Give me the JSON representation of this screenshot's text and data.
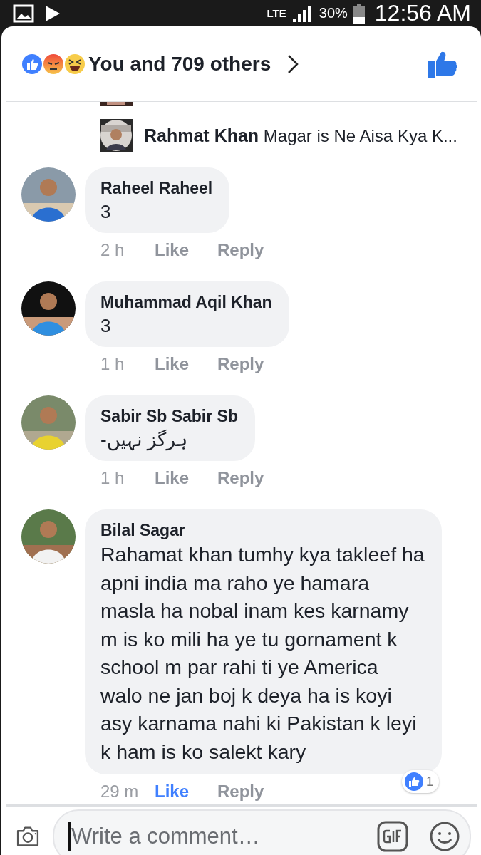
{
  "status_bar": {
    "network": "LTE",
    "battery": "30%",
    "time": "12:56 AM"
  },
  "reactions_header": {
    "summary": "You and 709 others",
    "liked": true
  },
  "reply_preview": {
    "author": "Rahmat Khan",
    "text": "Magar is Ne Aisa Kya K..."
  },
  "comments": [
    {
      "author": "Raheel Raheel",
      "text": "3",
      "time": "2 h",
      "like": "Like",
      "reply": "Reply",
      "liked": false
    },
    {
      "author": "Muhammad Aqil Khan",
      "text": "3",
      "time": "1 h",
      "like": "Like",
      "reply": "Reply",
      "liked": false
    },
    {
      "author": "Sabir Sb Sabir Sb",
      "text": "ہرگز نہیں-",
      "time": "1 h",
      "like": "Like",
      "reply": "Reply",
      "liked": false
    },
    {
      "author": "Bilal Sagar",
      "text": "Rahamat khan tumhy kya takleef ha apni india ma raho  ye hamara masla ha nobal inam kes karnamy m is ko mili ha ye tu gornament k school m par rahi ti ye America walo ne jan boj k deya ha is koyi asy karnama nahi ki Pakistan k leyi k ham is ko salekt kary",
      "time": "29 m",
      "like": "Like",
      "reply": "Reply",
      "liked": true,
      "reaction_count": "1"
    }
  ],
  "composer": {
    "placeholder": "Write a comment…"
  }
}
